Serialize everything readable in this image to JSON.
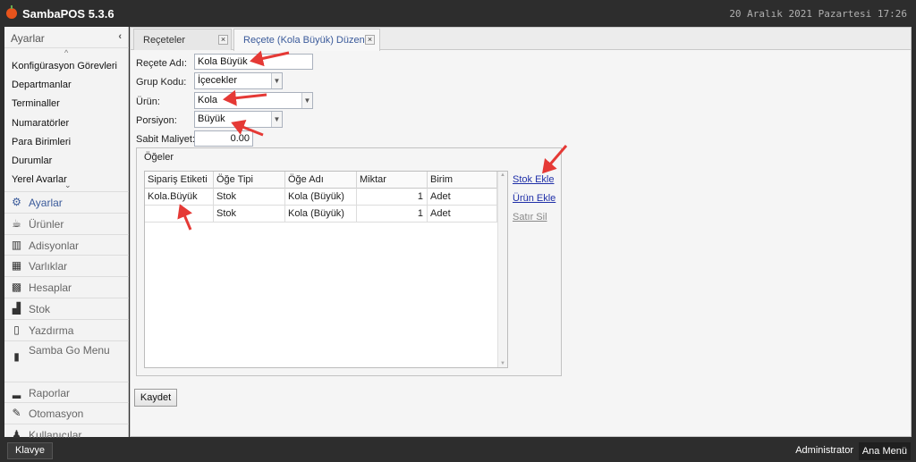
{
  "titlebar": {
    "title": "SambaPOS 5.3.6",
    "clock": "20 Aralık 2021 Pazartesi 17:26"
  },
  "sidebar": {
    "header": "Ayarlar",
    "collapse_glyph": "‹",
    "sub_items": [
      "Konfigürasyon Görevleri",
      "Departmanlar",
      "Terminaller",
      "Numaratörler",
      "Para Birimleri",
      "Durumlar",
      "Yerel Ayarlar"
    ],
    "menu": [
      {
        "label": "Ayarlar",
        "icon": "gear-icon",
        "glyph": "⚙"
      },
      {
        "label": "Ürünler",
        "icon": "coffee-cup-icon",
        "glyph": "☕"
      },
      {
        "label": "Adisyonlar",
        "icon": "books-icon",
        "glyph": "▥"
      },
      {
        "label": "Varlıklar",
        "icon": "table-icon",
        "glyph": "▦"
      },
      {
        "label": "Hesaplar",
        "icon": "calculator-icon",
        "glyph": "▩"
      },
      {
        "label": "Stok",
        "icon": "boxes-icon",
        "glyph": "▟"
      },
      {
        "label": "Yazdırma",
        "icon": "document-icon",
        "glyph": "▯"
      },
      {
        "label": "Samba Go Menu",
        "icon": "mobile-icon",
        "glyph": "▮"
      },
      {
        "label": "Raporlar",
        "icon": "bar-chart-icon",
        "glyph": "▂"
      },
      {
        "label": "Otomasyon",
        "icon": "pencil-icon",
        "glyph": "✎"
      },
      {
        "label": "Kullanıcılar",
        "icon": "user-icon",
        "glyph": "♟"
      }
    ]
  },
  "tabs": [
    {
      "label": "Reçeteler",
      "close": "×"
    },
    {
      "label": "Reçete (Kola Büyük) Düzenle",
      "close": "×"
    }
  ],
  "form": {
    "recipe_name_label": "Reçete Adı:",
    "recipe_name_value": "Kola Büyük",
    "group_code_label": "Grup Kodu:",
    "group_code_value": "İçecekler",
    "product_label": "Ürün:",
    "product_value": "Kola",
    "portion_label": "Porsiyon:",
    "portion_value": "Büyük",
    "fixed_cost_label": "Sabit Maliyet:",
    "fixed_cost_value": "0.00"
  },
  "items_group": {
    "title": "Öğeler",
    "columns": [
      "Sipariş Etiketi",
      "Öğe Tipi",
      "Öğe Adı",
      "Miktar",
      "Birim"
    ],
    "rows": [
      {
        "tag": "Kola.Büyük",
        "type": "Stok",
        "name": "Kola (Büyük)",
        "qty": "1",
        "unit": "Adet"
      },
      {
        "tag": "",
        "type": "Stok",
        "name": "Kola (Büyük)",
        "qty": "1",
        "unit": "Adet"
      }
    ],
    "actions": {
      "add_stock": "Stok Ekle",
      "add_product": "Ürün Ekle",
      "delete_row": "Satır Sil"
    }
  },
  "save_button": "Kaydet",
  "statusbar": {
    "keyboard": "Klavye",
    "user": "Administrator",
    "main_menu": "Ana Menü"
  },
  "colors": {
    "annotation_arrow": "#e53935",
    "link": "#1f2fa8",
    "active_tab": "#3a5a9a"
  }
}
